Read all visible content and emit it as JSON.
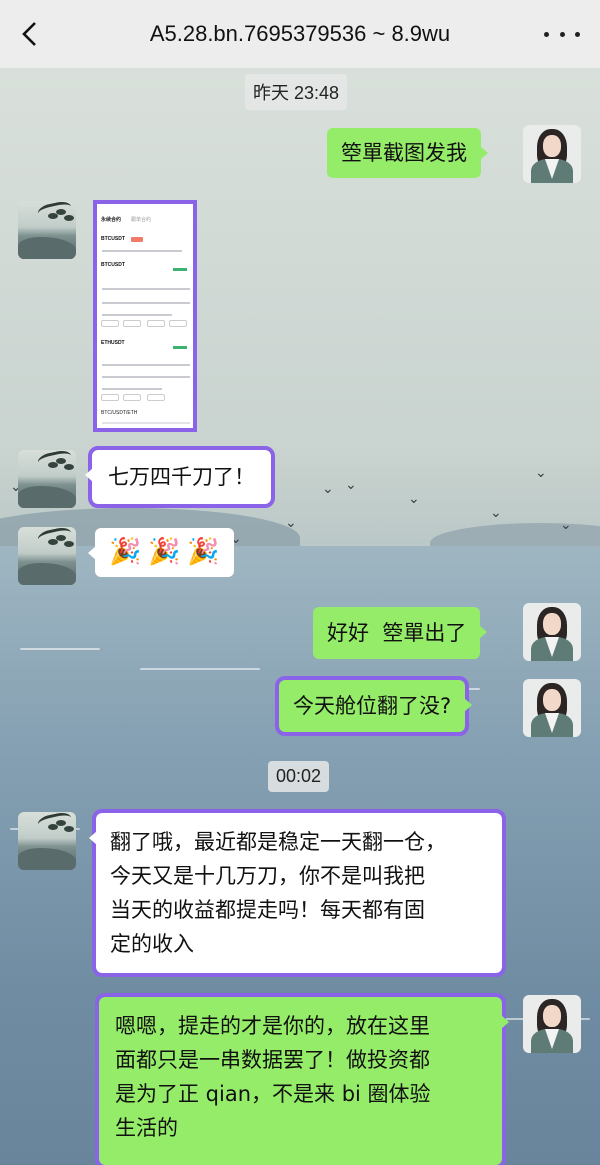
{
  "header": {
    "title": "A5.28.bn.7695379536 ~ 8.9wu",
    "back_icon": "chevron-left-icon",
    "more_icon": "more-dots-icon"
  },
  "timestamps": [
    "昨天 23:48",
    "00:02"
  ],
  "messages": [
    {
      "side": "right",
      "type": "text",
      "lines": [
        "箜單截图发我"
      ]
    },
    {
      "side": "left",
      "type": "image",
      "image": {
        "tabs": [
          "永续合约",
          "跟单合约"
        ],
        "symbol_1": "BTCUSDT",
        "symbol_2": "ETHUSDT",
        "footer": "BTC/USDT/ETH"
      }
    },
    {
      "side": "left",
      "type": "text",
      "lines": [
        "七万四千刀了！"
      ]
    },
    {
      "side": "left",
      "type": "emoji",
      "emoji": [
        "🎉",
        "🎉",
        "🎉"
      ]
    },
    {
      "side": "right",
      "type": "text",
      "lines": [
        "好好  箜單出了"
      ]
    },
    {
      "side": "right",
      "type": "text",
      "lines": [
        "今天舱位翻了没?"
      ]
    },
    {
      "side": "left",
      "type": "text",
      "lines": [
        "翻了哦，最近都是稳定一天翻一仓，",
        "今天又是十几万刀，你不是叫我把",
        "当天的收益都提走吗！每天都有固",
        "定的收入"
      ]
    },
    {
      "side": "right",
      "type": "text",
      "lines": [
        "嗯嗯，提走的才是你的，放在这里",
        "面都只是一串数据罢了！做投资都",
        "是为了正 qian，不是来 bi 圈体验",
        "生活的"
      ]
    }
  ],
  "colors": {
    "header_bg": "#ededed",
    "bubble_green": "#95ec69",
    "bubble_white": "#ffffff",
    "highlight_frame": "#8a63e8"
  },
  "icons": {
    "left_avatar": "landscape-avatar-icon",
    "right_avatar": "woman-portrait-avatar-icon"
  }
}
